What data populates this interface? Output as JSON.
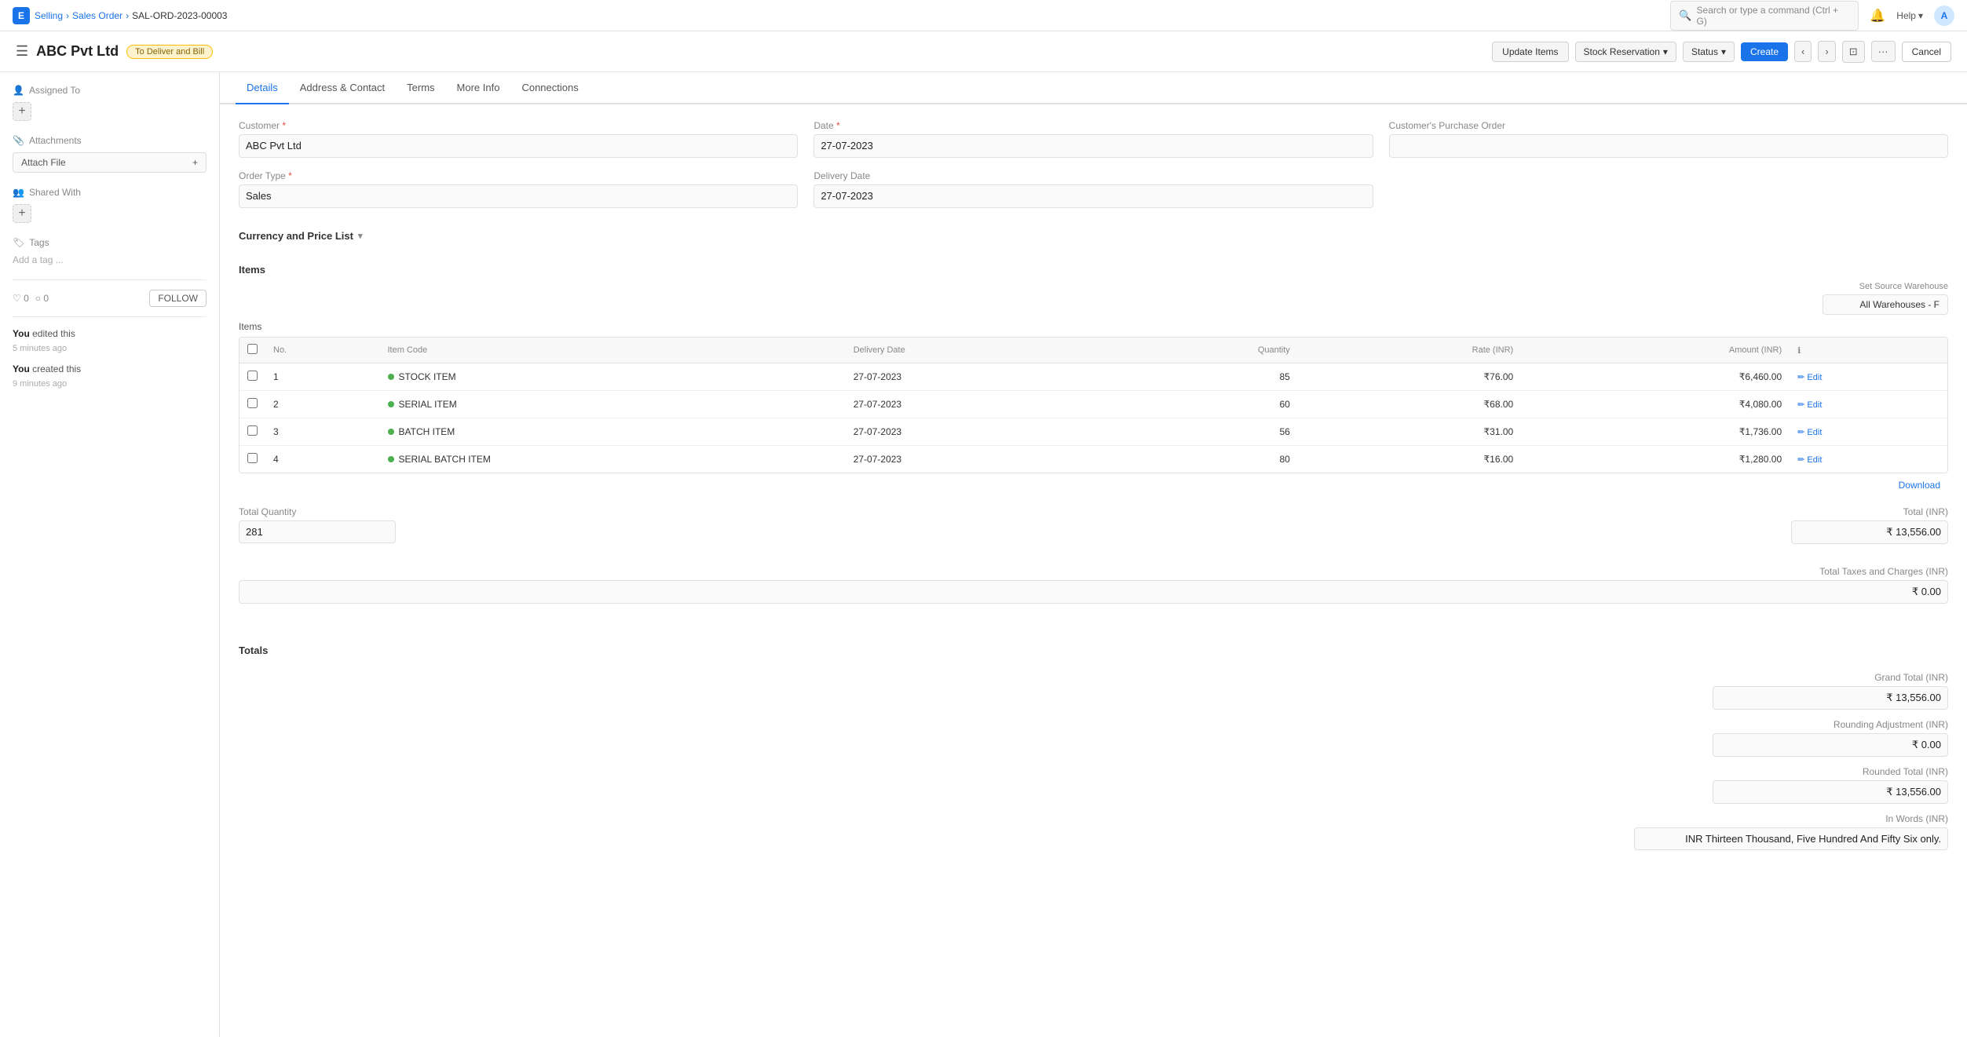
{
  "app": {
    "logo": "E",
    "breadcrumbs": [
      "Selling",
      "Sales Order",
      "SAL-ORD-2023-00003"
    ]
  },
  "topnav": {
    "search_placeholder": "Search or type a command (Ctrl + G)",
    "help_label": "Help",
    "avatar": "A"
  },
  "docheader": {
    "title": "ABC Pvt Ltd",
    "status_badge": "To Deliver and Bill",
    "update_items_label": "Update Items",
    "stock_reservation_label": "Stock Reservation",
    "status_label": "Status",
    "create_label": "Create",
    "cancel_label": "Cancel"
  },
  "sidebar": {
    "assigned_to_label": "Assigned To",
    "attachments_label": "Attachments",
    "attach_file_label": "Attach File",
    "shared_with_label": "Shared With",
    "tags_label": "Tags",
    "add_tag_placeholder": "Add a tag ...",
    "likes": "0",
    "comments": "0",
    "follow_label": "FOLLOW",
    "activity": [
      {
        "user": "You",
        "action": "edited this",
        "time": "5 minutes ago"
      },
      {
        "user": "You",
        "action": "created this",
        "time": "9 minutes ago"
      }
    ]
  },
  "tabs": [
    {
      "id": "details",
      "label": "Details",
      "active": true
    },
    {
      "id": "address",
      "label": "Address & Contact",
      "active": false
    },
    {
      "id": "terms",
      "label": "Terms",
      "active": false
    },
    {
      "id": "moreinfo",
      "label": "More Info",
      "active": false
    },
    {
      "id": "connections",
      "label": "Connections",
      "active": false
    }
  ],
  "form": {
    "customer_label": "Customer",
    "customer_value": "ABC Pvt Ltd",
    "date_label": "Date",
    "date_value": "27-07-2023",
    "purchase_order_label": "Customer's Purchase Order",
    "purchase_order_value": "",
    "order_type_label": "Order Type",
    "order_type_value": "Sales",
    "delivery_date_label": "Delivery Date",
    "delivery_date_value": "27-07-2023"
  },
  "currency_section": {
    "title": "Currency and Price List"
  },
  "items_section": {
    "title": "Items",
    "warehouse_label": "Set Source Warehouse",
    "warehouse_value": "All Warehouses - F",
    "items_sub_label": "Items",
    "columns": {
      "no": "No.",
      "item_code": "Item Code",
      "delivery_date": "Delivery Date",
      "quantity": "Quantity",
      "rate": "Rate (INR)",
      "amount": "Amount (INR)"
    },
    "rows": [
      {
        "no": "1",
        "item_code": "STOCK ITEM",
        "delivery_date": "27-07-2023",
        "quantity": "85",
        "rate": "₹76.00",
        "amount": "₹6,460.00"
      },
      {
        "no": "2",
        "item_code": "SERIAL ITEM",
        "delivery_date": "27-07-2023",
        "quantity": "60",
        "rate": "₹68.00",
        "amount": "₹4,080.00"
      },
      {
        "no": "3",
        "item_code": "BATCH ITEM",
        "delivery_date": "27-07-2023",
        "quantity": "56",
        "rate": "₹31.00",
        "amount": "₹1,736.00"
      },
      {
        "no": "4",
        "item_code": "SERIAL BATCH ITEM",
        "delivery_date": "27-07-2023",
        "quantity": "80",
        "rate": "₹16.00",
        "amount": "₹1,280.00"
      }
    ],
    "edit_label": "Edit",
    "download_label": "Download",
    "total_quantity_label": "Total Quantity",
    "total_quantity_value": "281",
    "total_inr_label": "Total (INR)",
    "total_inr_value": "₹ 13,556.00",
    "taxes_label": "Total Taxes and Charges (INR)",
    "taxes_value": "₹ 0.00"
  },
  "totals_section": {
    "title": "Totals",
    "grand_total_label": "Grand Total (INR)",
    "grand_total_value": "₹ 13,556.00",
    "rounding_label": "Rounding Adjustment (INR)",
    "rounding_value": "₹ 0.00",
    "rounded_total_label": "Rounded Total (INR)",
    "rounded_total_value": "₹ 13,556.00",
    "in_words_label": "In Words (INR)",
    "in_words_value": "INR Thirteen Thousand, Five Hundred And Fifty Six only."
  }
}
